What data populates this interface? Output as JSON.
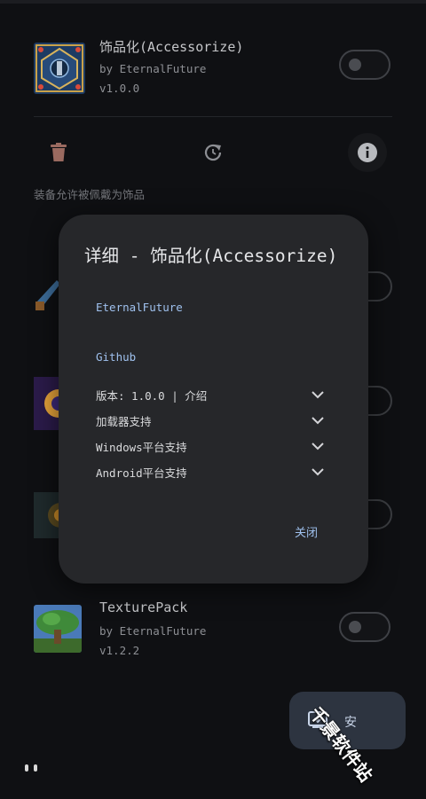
{
  "mods": [
    {
      "name": "饰品化(Accessorize)",
      "author": "by EternalFuture",
      "version": "v1.0.0",
      "enabled": false
    },
    {
      "name": "TexturePack",
      "author": "by EternalFuture",
      "version": "v1.2.2",
      "enabled": false
    }
  ],
  "mod_description": "装备允许被佩戴为饰品",
  "actions": {
    "delete": "trash-icon",
    "refresh": "refresh-icon",
    "info": "info-icon"
  },
  "dialog": {
    "title": "详细 - 饰品化(Accessorize)",
    "author_link": "EternalFuture",
    "github_link": "Github",
    "sections": [
      {
        "label": "版本: 1.0.0 | 介绍"
      },
      {
        "label": "加载器支持"
      },
      {
        "label": "Windows平台支持"
      },
      {
        "label": "Android平台支持"
      }
    ],
    "close_label": "关闭"
  },
  "fab": {
    "label": "安",
    "icon": "install-icon"
  },
  "watermark": "千景软件站",
  "colors": {
    "background": "#0f1013",
    "dialog": "#26272a",
    "link": "#9fc1ee",
    "fab": "#2d3440"
  }
}
